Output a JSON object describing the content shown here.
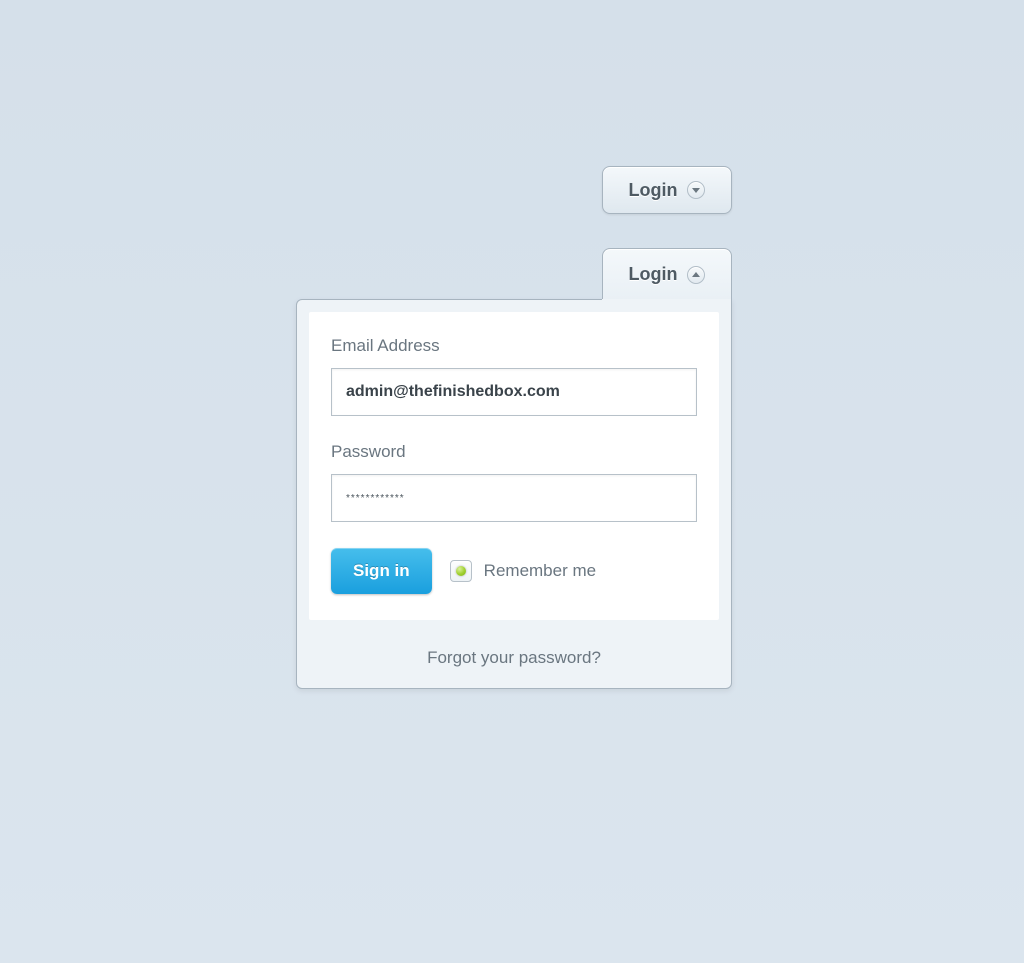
{
  "collapsed_button": {
    "label": "Login"
  },
  "expanded": {
    "tab_label": "Login",
    "email_label": "Email Address",
    "email_value": "admin@thefinishedbox.com",
    "password_label": "Password",
    "password_value": "************",
    "signin_label": "Sign in",
    "remember_label": "Remember me",
    "remember_checked": true,
    "forgot_label": "Forgot your password?"
  },
  "colors": {
    "accent": "#1a9fde",
    "bg": "#d8e2eb"
  }
}
